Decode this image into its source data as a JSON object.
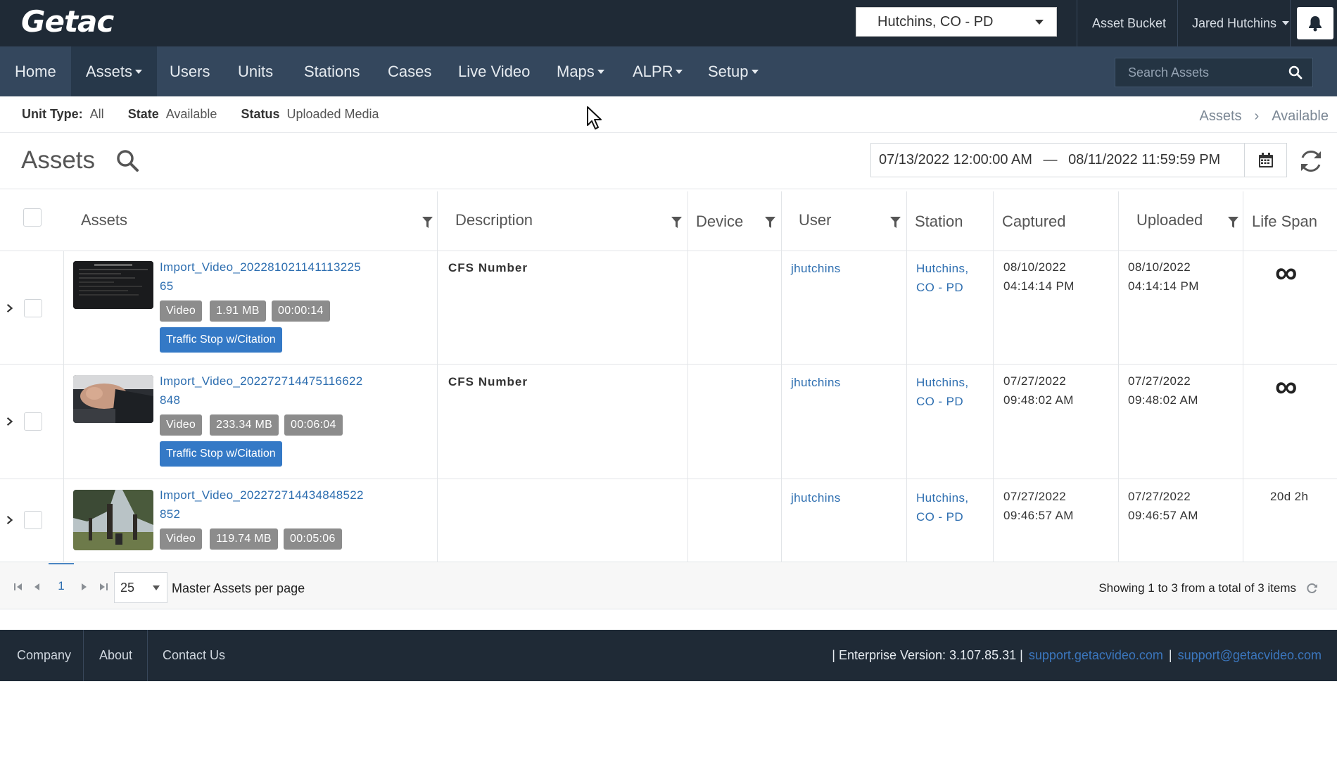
{
  "topbar": {
    "logo": "Getac",
    "agency": "Hutchins, CO - PD",
    "asset_bucket": "Asset Bucket",
    "user": "Jared Hutchins"
  },
  "nav": {
    "items": [
      {
        "label": "Home"
      },
      {
        "label": "Assets"
      },
      {
        "label": "Users"
      },
      {
        "label": "Units"
      },
      {
        "label": "Stations"
      },
      {
        "label": "Cases"
      },
      {
        "label": "Live Video"
      },
      {
        "label": "Maps"
      },
      {
        "label": "ALPR"
      },
      {
        "label": "Setup"
      }
    ],
    "search_placeholder": "Search Assets"
  },
  "filters": {
    "unit_type_label": "Unit Type:",
    "unit_type_value": "All",
    "state_label": "State",
    "state_value": "Available",
    "status_label": "Status",
    "status_value": "Uploaded Media"
  },
  "breadcrumb": [
    "Assets",
    "Available"
  ],
  "page": {
    "title": "Assets",
    "date_from": "07/13/2022 12:00:00 AM",
    "date_sep": "—",
    "date_to": "08/11/2022 11:59:59 PM"
  },
  "table": {
    "columns": [
      "Assets",
      "Description",
      "Device",
      "User",
      "Station",
      "Captured",
      "Uploaded",
      "Life Span"
    ],
    "rows": [
      {
        "name_line1": "Import_Video_202281021141113225",
        "name_line2": "65",
        "type": "Video",
        "size": "1.91 MB",
        "duration": "00:00:14",
        "category": "Traffic Stop w/Citation",
        "description": "CFS Number",
        "device": "",
        "user": "jhutchins",
        "station_line1": "Hutchins,",
        "station_line2": "CO - PD",
        "captured_date": "08/10/2022",
        "captured_time": "04:14:14 PM",
        "uploaded_date": "08/10/2022",
        "uploaded_time": "04:14:14 PM",
        "lifespan": "∞"
      },
      {
        "name_line1": "Import_Video_202272714475116622",
        "name_line2": "848",
        "type": "Video",
        "size": "233.34 MB",
        "duration": "00:06:04",
        "category": "Traffic Stop w/Citation",
        "description": "CFS Number",
        "device": "",
        "user": "jhutchins",
        "station_line1": "Hutchins,",
        "station_line2": "CO - PD",
        "captured_date": "07/27/2022",
        "captured_time": "09:48:02 AM",
        "uploaded_date": "07/27/2022",
        "uploaded_time": "09:48:02 AM",
        "lifespan": "∞"
      },
      {
        "name_line1": "Import_Video_202272714434848522",
        "name_line2": "852",
        "type": "Video",
        "size": "119.74 MB",
        "duration": "00:05:06",
        "category": "",
        "description": "",
        "device": "",
        "user": "jhutchins",
        "station_line1": "Hutchins,",
        "station_line2": "CO - PD",
        "captured_date": "07/27/2022",
        "captured_time": "09:46:57 AM",
        "uploaded_date": "07/27/2022",
        "uploaded_time": "09:46:57 AM",
        "lifespan": "20d 2h"
      }
    ]
  },
  "pager": {
    "current_page": "1",
    "page_size": "25",
    "per_page_label": "Master Assets per page",
    "summary": "Showing 1 to 3 from a total of 3 items"
  },
  "footer": {
    "links": [
      "Company",
      "About",
      "Contact Us"
    ],
    "version_prefix": "| Enterprise Version: 3.107.85.31 |",
    "support_site": "support.getacvideo.com",
    "sep": "|",
    "support_email": "support@getacvideo.com"
  },
  "colors": {
    "topbar": "#1f2a36",
    "navbar": "#34475d",
    "link": "#2d6eb0",
    "category_badge": "#3479c6",
    "meta_badge": "#8c8c8c"
  }
}
